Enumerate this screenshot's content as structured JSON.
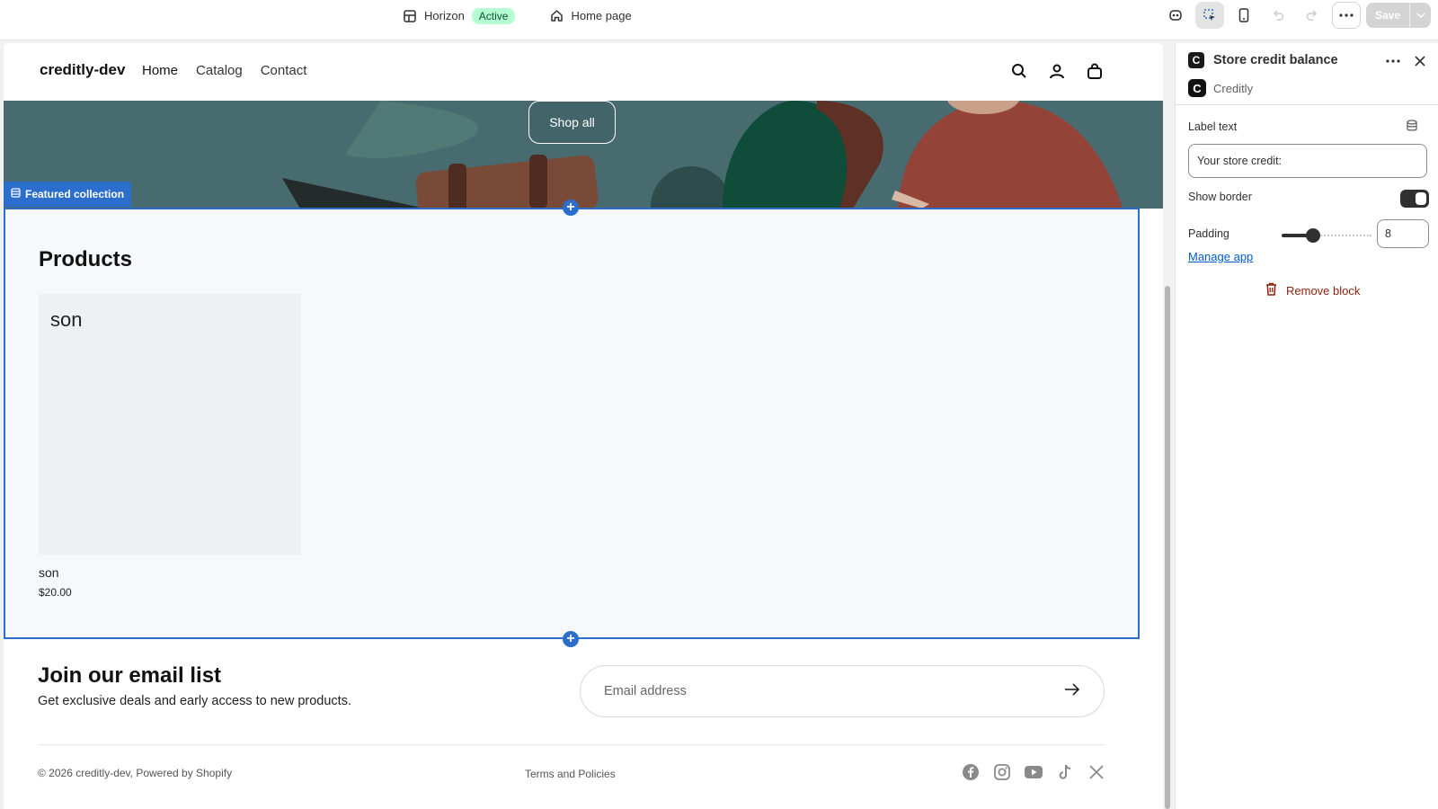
{
  "topbar": {
    "theme_name": "Horizon",
    "theme_status": "Active",
    "page_name": "Home page",
    "save_label": "Save"
  },
  "storefront": {
    "logo": "creditly-dev",
    "nav": [
      "Home",
      "Catalog",
      "Contact"
    ],
    "hero_button": "Shop all",
    "section_tag": "Featured collection",
    "collection_title": "Products",
    "product": {
      "image_text": "son",
      "name": "son",
      "price": "$20.00"
    },
    "email": {
      "title": "Join our email list",
      "subtitle": "Get exclusive deals and early access to new products.",
      "placeholder": "Email address"
    },
    "footer": {
      "copyright": "© 2026 creditly-dev, Powered by Shopify",
      "terms": "Terms and Policies",
      "social_icons": [
        "facebook-icon",
        "instagram-icon",
        "youtube-icon",
        "tiktok-icon",
        "x-icon"
      ]
    }
  },
  "panel": {
    "title": "Store credit balance",
    "app_letter": "C",
    "app_name": "Creditly",
    "label_text_label": "Label text",
    "label_text_value": "Your store credit:",
    "show_border_label": "Show border",
    "show_border_on": true,
    "padding_label": "Padding",
    "padding_value": "8",
    "padding_fraction": 0.35,
    "manage_app": "Manage app",
    "remove_block": "Remove block"
  },
  "colors": {
    "accent": "#2c6ecb",
    "hero_bg": "#476b6f",
    "badge_bg": "#b4fed2",
    "danger": "#8e1f0b"
  }
}
